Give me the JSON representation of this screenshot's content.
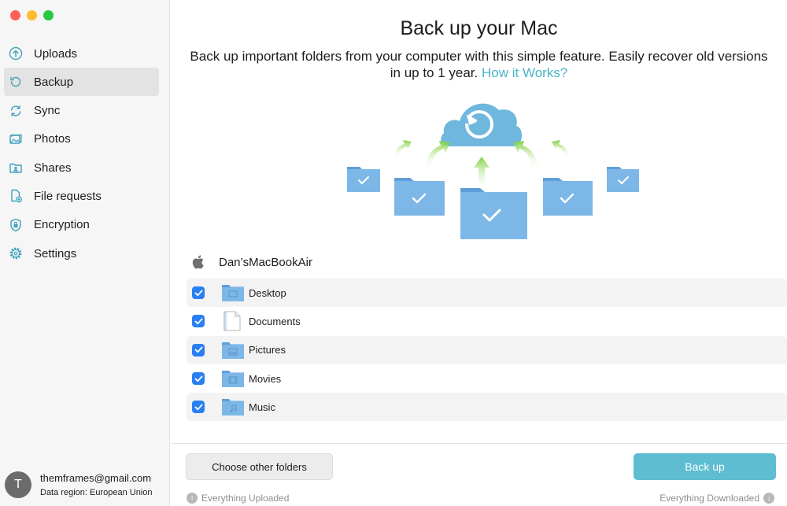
{
  "sidebar": {
    "items": [
      {
        "label": "Uploads",
        "icon": "upload-icon"
      },
      {
        "label": "Backup",
        "icon": "backup-icon",
        "active": true
      },
      {
        "label": "Sync",
        "icon": "sync-icon"
      },
      {
        "label": "Photos",
        "icon": "photos-icon"
      },
      {
        "label": "Shares",
        "icon": "shares-icon"
      },
      {
        "label": "File requests",
        "icon": "file-requests-icon"
      },
      {
        "label": "Encryption",
        "icon": "lock-icon"
      },
      {
        "label": "Settings",
        "icon": "gear-icon"
      }
    ],
    "account": {
      "avatar_letter": "T",
      "email": "themframes@gmail.com",
      "region": "Data region: European Union"
    }
  },
  "main": {
    "title": "Back up your Mac",
    "subtitle": "Back up important folders from your computer with this simple feature. Easily recover old versions in up to 1 year.",
    "how_link": "How it Works?",
    "device_name": "Dan’sMacBookAir",
    "folders": [
      {
        "name": "Desktop",
        "checked": true,
        "icon": "desktop-folder-icon"
      },
      {
        "name": "Documents",
        "checked": true,
        "icon": "document-icon"
      },
      {
        "name": "Pictures",
        "checked": true,
        "icon": "pictures-folder-icon"
      },
      {
        "name": "Movies",
        "checked": true,
        "icon": "movies-folder-icon"
      },
      {
        "name": "Music",
        "checked": true,
        "icon": "music-folder-icon"
      }
    ],
    "choose_button": "Choose other folders",
    "backup_button": "Back up",
    "status_uploaded": "Everything Uploaded",
    "status_downloaded": "Everything Downloaded"
  },
  "colors": {
    "accent": "#5ebdd0",
    "link": "#4ab3c9",
    "checkbox": "#2a7ff3",
    "folder": "#6ea7dc"
  }
}
